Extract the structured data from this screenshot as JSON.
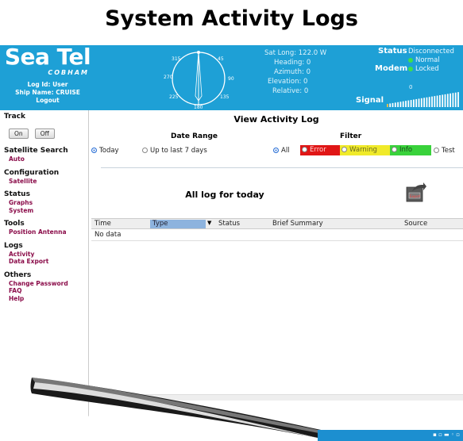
{
  "page_title": "System Activity Logs",
  "header": {
    "brand": "Sea Tel",
    "brand_sub": "COBHAM",
    "log_id": "Log Id: User",
    "ship_name": "Ship Name: CRUISE",
    "logout": "Logout",
    "compass": {
      "n315": "315",
      "n45": "45",
      "n270": "270",
      "n90": "90",
      "n225": "225",
      "n135": "135",
      "n180": "180"
    },
    "telemetry": {
      "sat_long": "Sat Long: 122.0 W",
      "heading": "Heading: 0",
      "azimuth": "Azimuth: 0",
      "elevation": "Elevation: 0",
      "relative": "Relative: 0"
    },
    "status_label": "Status",
    "status_value": "Disconnected",
    "status_normal": "Normal",
    "modem_label": "Modem",
    "modem_value": "Locked",
    "signal_label": "Signal",
    "signal_value": "0"
  },
  "sidebar": {
    "track_title": "Track",
    "track_on": "On",
    "track_off": "Off",
    "satellite_search_title": "Satellite Search",
    "auto": "Auto",
    "configuration_title": "Configuration",
    "satellite": "Satellite",
    "status_title": "Status",
    "graphs": "Graphs",
    "system": "System",
    "tools_title": "Tools",
    "position_antenna": "Position Antenna",
    "logs_title": "Logs",
    "activity": "Activity",
    "data_export": "Data Export",
    "others_title": "Others",
    "change_password": "Change Password",
    "faq": "FAQ",
    "help": "Help"
  },
  "main": {
    "view_title": "View Activity Log",
    "date_range_label": "Date Range",
    "filter_label": "Filter",
    "today": "Today",
    "last7": "Up to last 7 days",
    "all": "All",
    "error": "Error",
    "warning": "Warning",
    "info": "Info",
    "test": "Test",
    "log_title": "All log for today",
    "export_icon_label": "Export",
    "columns": {
      "time": "Time",
      "type": "Type",
      "status": "Status",
      "summary": "Brief Summary",
      "source": "Source"
    },
    "no_data": "No data"
  },
  "colors": {
    "header_bg": "#1ea0d6",
    "link": "#8b0d4a",
    "error_chip": "#e01616",
    "warning_chip": "#f0ea2a",
    "info_chip": "#39d23b"
  }
}
